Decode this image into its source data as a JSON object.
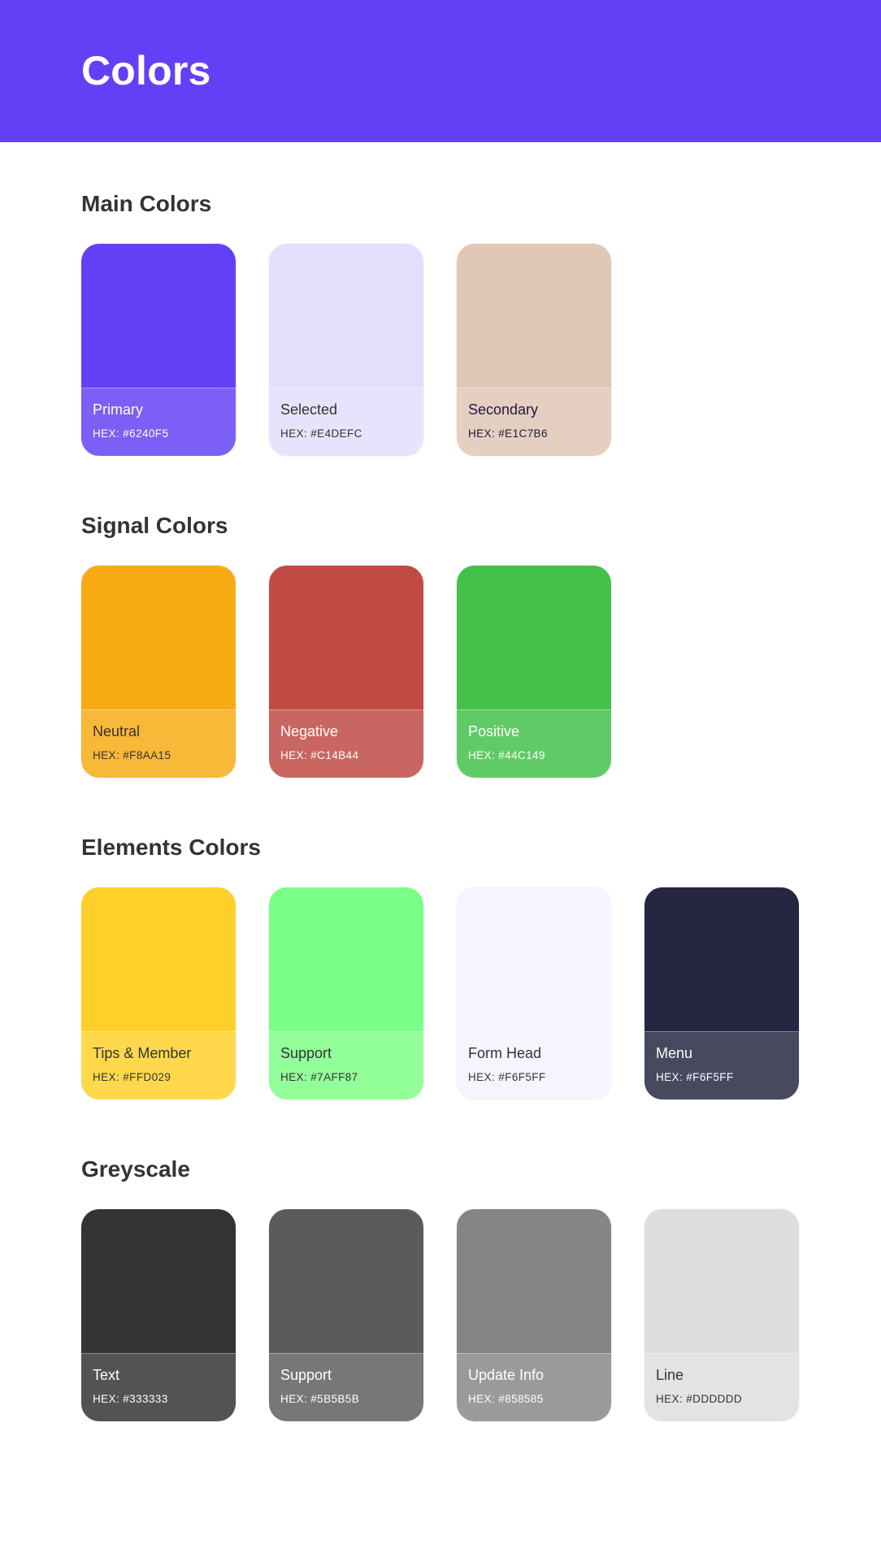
{
  "header": {
    "title": "Colors",
    "background": "#6240F5"
  },
  "sections": [
    {
      "title": "Main Colors",
      "cards": [
        {
          "name": "Primary",
          "hex_label": "HEX: #6240F5",
          "color": "#6240F5",
          "info_bg": "#7B5FF6",
          "text_color": "#FFFFFF"
        },
        {
          "name": "Selected",
          "hex_label": "HEX: #E4DEFC",
          "color": "#E4DEFC",
          "info_bg": "#E8E3FC",
          "text_color": "#333333"
        },
        {
          "name": "Secondary",
          "hex_label": "HEX: #E1C7B6",
          "color": "#E1C7B6",
          "info_bg": "#E5CFC1",
          "text_color": "#1E1B3A"
        }
      ]
    },
    {
      "title": "Signal Colors",
      "cards": [
        {
          "name": "Neutral",
          "hex_label": "HEX: #F8AA15",
          "color": "#F8AA15",
          "info_bg": "#F8B838",
          "text_color": "#333333"
        },
        {
          "name": "Negative",
          "hex_label": "HEX: #C14B44",
          "color": "#C14B44",
          "info_bg": "#CA6661",
          "text_color": "#FFFFFF"
        },
        {
          "name": "Positive",
          "hex_label": "HEX: #44C149",
          "color": "#44C149",
          "info_bg": "#60CB66",
          "text_color": "#FFFFFF"
        }
      ]
    },
    {
      "title": "Elements Colors",
      "cards": [
        {
          "name": "Tips & Member",
          "hex_label": "HEX: #FFD029",
          "color": "#FFD029",
          "info_bg": "#FFD94B",
          "text_color": "#333333"
        },
        {
          "name": "Support",
          "hex_label": "HEX: #7AFF87",
          "color": "#7AFF87",
          "info_bg": "#93FF98",
          "text_color": "#333333"
        },
        {
          "name": "Form Head",
          "hex_label": "HEX: #F6F5FF",
          "color": "#F6F5FF",
          "info_bg": "#F6F5FF",
          "text_color": "#333333"
        },
        {
          "name": "Menu",
          "hex_label": "HEX: #F6F5FF",
          "color": "#262642",
          "info_bg": "#48485E",
          "text_color": "#FFFFFF"
        }
      ]
    },
    {
      "title": "Greyscale",
      "cards": [
        {
          "name": "Text",
          "hex_label": "HEX: #333333",
          "color": "#333333",
          "info_bg": "#535353",
          "text_color": "#FFFFFF"
        },
        {
          "name": "Support",
          "hex_label": "HEX: #5B5B5B",
          "color": "#5B5B5B",
          "info_bg": "#777777",
          "text_color": "#FFFFFF"
        },
        {
          "name": "Update Info",
          "hex_label": "HEX: #858585",
          "color": "#858585",
          "info_bg": "#9A9A9A",
          "text_color": "#FFFFFF"
        },
        {
          "name": "Line",
          "hex_label": "HEX: #DDDDDD",
          "color": "#DDDDDD",
          "info_bg": "#E3E3E3",
          "text_color": "#333333"
        }
      ]
    }
  ]
}
